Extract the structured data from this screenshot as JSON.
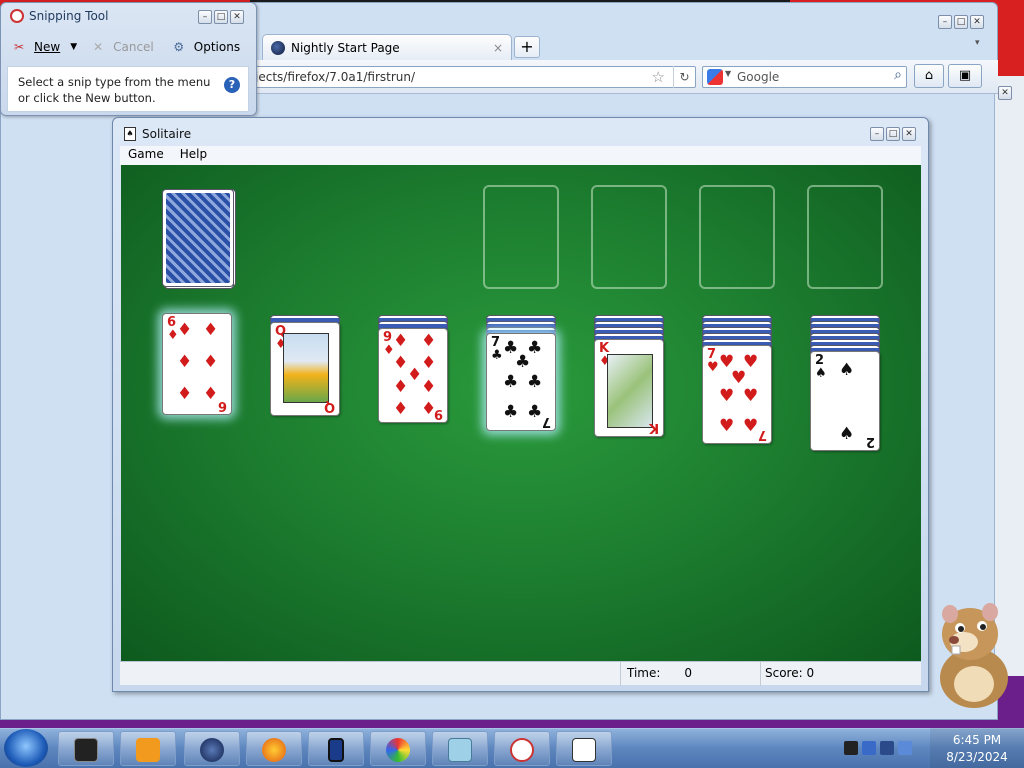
{
  "desktop": {
    "colors": [
      "#d92020",
      "#e07a10",
      "#e8c21a",
      "#2f9a2f",
      "#1f4fc0",
      "#6b1f8a"
    ]
  },
  "firefox": {
    "tab_title": "Nightly Start Page",
    "tab_close": "×",
    "new_tab": "+",
    "url": "jects/firefox/7.0a1/firstrun/",
    "search_placeholder": "Google",
    "home_icon": "⌂",
    "bookmark_icon": "▣",
    "chevron": "▾"
  },
  "snipping_tool": {
    "title": "Snipping Tool",
    "new_label": "New",
    "cancel_label": "Cancel",
    "options_label": "Options",
    "help_text_1": "Select a snip type from the menu",
    "help_text_2": "or click the New button.",
    "help_icon": "?"
  },
  "solitaire": {
    "title": "Solitaire",
    "menu": [
      "Game",
      "Help"
    ],
    "status": {
      "time_label": "Time:",
      "time_value": "0",
      "score_label": "Score:",
      "score_value": "0"
    },
    "tableau": [
      {
        "rank": "6",
        "suit": "♦",
        "color": "red"
      },
      {
        "rank": "Q",
        "suit": "♦",
        "color": "red"
      },
      {
        "rank": "9",
        "suit": "♦",
        "color": "red"
      },
      {
        "rank": "7",
        "suit": "♣",
        "color": "black"
      },
      {
        "rank": "K",
        "suit": "♦",
        "color": "red"
      },
      {
        "rank": "7",
        "suit": "♥",
        "color": "red"
      },
      {
        "rank": "2",
        "suit": "♠",
        "color": "black"
      }
    ]
  },
  "taskbar": {
    "clock_time": "6:45 PM",
    "clock_date": "8/23/2024",
    "apps": [
      "terminal",
      "media-player",
      "globe",
      "firefox",
      "phone",
      "paint",
      "notepad",
      "snipping-tool",
      "solitaire"
    ]
  },
  "window_buttons": {
    "minimize": "–",
    "maximize": "□",
    "close": "✕"
  }
}
